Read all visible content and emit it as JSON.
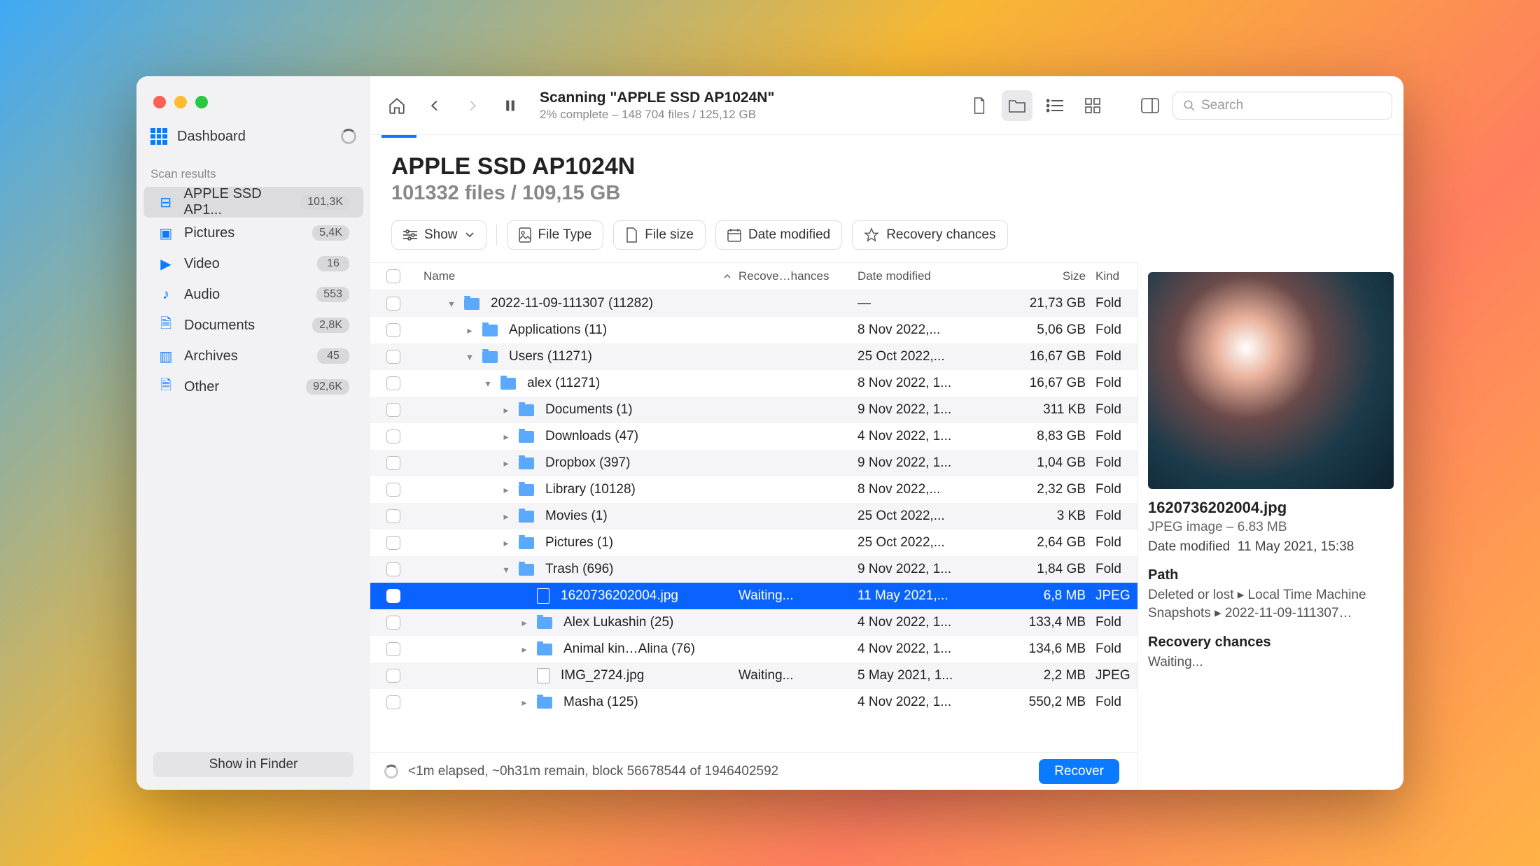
{
  "sidebar": {
    "dashboard": "Dashboard",
    "section": "Scan results",
    "items": [
      {
        "label": "APPLE SSD AP1...",
        "badge": "101,3K",
        "icon": "drive"
      },
      {
        "label": "Pictures",
        "badge": "5,4K",
        "icon": "image"
      },
      {
        "label": "Video",
        "badge": "16",
        "icon": "video"
      },
      {
        "label": "Audio",
        "badge": "553",
        "icon": "audio"
      },
      {
        "label": "Documents",
        "badge": "2,8K",
        "icon": "doc"
      },
      {
        "label": "Archives",
        "badge": "45",
        "icon": "archive"
      },
      {
        "label": "Other",
        "badge": "92,6K",
        "icon": "other"
      }
    ],
    "show_finder": "Show in Finder"
  },
  "toolbar": {
    "title": "Scanning \"APPLE SSD AP1024N\"",
    "subtitle": "2% complete – 148 704 files / 125,12 GB",
    "search_placeholder": "Search"
  },
  "header": {
    "title": "APPLE SSD AP1024N",
    "subtitle": "101332 files / 109,15 GB"
  },
  "filters": {
    "show": "Show",
    "file_type": "File Type",
    "file_size": "File size",
    "date_modified": "Date modified",
    "recovery": "Recovery chances"
  },
  "columns": {
    "name": "Name",
    "recovery": "Recove…hances",
    "date": "Date modified",
    "size": "Size",
    "kind": "Kind"
  },
  "rows": [
    {
      "indent": 1,
      "disc": "v",
      "type": "folder",
      "name": "2022-11-09-111307 (11282)",
      "rec": "",
      "date": "—",
      "size": "21,73 GB",
      "kind": "Fold"
    },
    {
      "indent": 2,
      "disc": ">",
      "type": "folder",
      "name": "Applications (11)",
      "rec": "",
      "date": "8 Nov 2022,...",
      "size": "5,06 GB",
      "kind": "Fold"
    },
    {
      "indent": 2,
      "disc": "v",
      "type": "folder",
      "name": "Users (11271)",
      "rec": "",
      "date": "25 Oct 2022,...",
      "size": "16,67 GB",
      "kind": "Fold"
    },
    {
      "indent": 3,
      "disc": "v",
      "type": "folder",
      "name": "alex (11271)",
      "rec": "",
      "date": "8 Nov 2022, 1...",
      "size": "16,67 GB",
      "kind": "Fold"
    },
    {
      "indent": 4,
      "disc": ">",
      "type": "folder",
      "name": "Documents (1)",
      "rec": "",
      "date": "9 Nov 2022, 1...",
      "size": "311 KB",
      "kind": "Fold"
    },
    {
      "indent": 4,
      "disc": ">",
      "type": "folder",
      "name": "Downloads (47)",
      "rec": "",
      "date": "4 Nov 2022, 1...",
      "size": "8,83 GB",
      "kind": "Fold"
    },
    {
      "indent": 4,
      "disc": ">",
      "type": "folder",
      "name": "Dropbox (397)",
      "rec": "",
      "date": "9 Nov 2022, 1...",
      "size": "1,04 GB",
      "kind": "Fold"
    },
    {
      "indent": 4,
      "disc": ">",
      "type": "folder",
      "name": "Library (10128)",
      "rec": "",
      "date": "8 Nov 2022,...",
      "size": "2,32 GB",
      "kind": "Fold"
    },
    {
      "indent": 4,
      "disc": ">",
      "type": "folder",
      "name": "Movies (1)",
      "rec": "",
      "date": "25 Oct 2022,...",
      "size": "3 KB",
      "kind": "Fold"
    },
    {
      "indent": 4,
      "disc": ">",
      "type": "folder",
      "name": "Pictures (1)",
      "rec": "",
      "date": "25 Oct 2022,...",
      "size": "2,64 GB",
      "kind": "Fold"
    },
    {
      "indent": 4,
      "disc": "v",
      "type": "folder",
      "name": "Trash (696)",
      "rec": "",
      "date": "9 Nov 2022, 1...",
      "size": "1,84 GB",
      "kind": "Fold"
    },
    {
      "indent": 5,
      "disc": "",
      "type": "file",
      "name": "1620736202004.jpg",
      "rec": "Waiting...",
      "date": "11 May 2021,...",
      "size": "6,8 MB",
      "kind": "JPEG",
      "selected": true,
      "checked": true
    },
    {
      "indent": 5,
      "disc": ">",
      "type": "folder",
      "name": "Alex Lukashin (25)",
      "rec": "",
      "date": "4 Nov 2022, 1...",
      "size": "133,4 MB",
      "kind": "Fold"
    },
    {
      "indent": 5,
      "disc": ">",
      "type": "folder",
      "name": "Animal kin…Alina (76)",
      "rec": "",
      "date": "4 Nov 2022, 1...",
      "size": "134,6 MB",
      "kind": "Fold"
    },
    {
      "indent": 5,
      "disc": "",
      "type": "file",
      "name": "IMG_2724.jpg",
      "rec": "Waiting...",
      "date": "5 May 2021, 1...",
      "size": "2,2 MB",
      "kind": "JPEG"
    },
    {
      "indent": 5,
      "disc": ">",
      "type": "folder",
      "name": "Masha (125)",
      "rec": "",
      "date": "4 Nov 2022, 1...",
      "size": "550,2 MB",
      "kind": "Fold"
    }
  ],
  "preview": {
    "filename": "1620736202004.jpg",
    "kind_size": "JPEG image – 6.83 MB",
    "date_label": "Date modified",
    "date_value": "11 May 2021, 15:38",
    "path_label": "Path",
    "path_value": "Deleted or lost ▸ Local Time Machine Snapshots ▸ 2022-11-09-111307…",
    "recovery_label": "Recovery chances",
    "recovery_value": "Waiting..."
  },
  "footer": {
    "status": "<1m elapsed, ~0h31m remain, block 56678544 of 1946402592",
    "recover": "Recover"
  }
}
